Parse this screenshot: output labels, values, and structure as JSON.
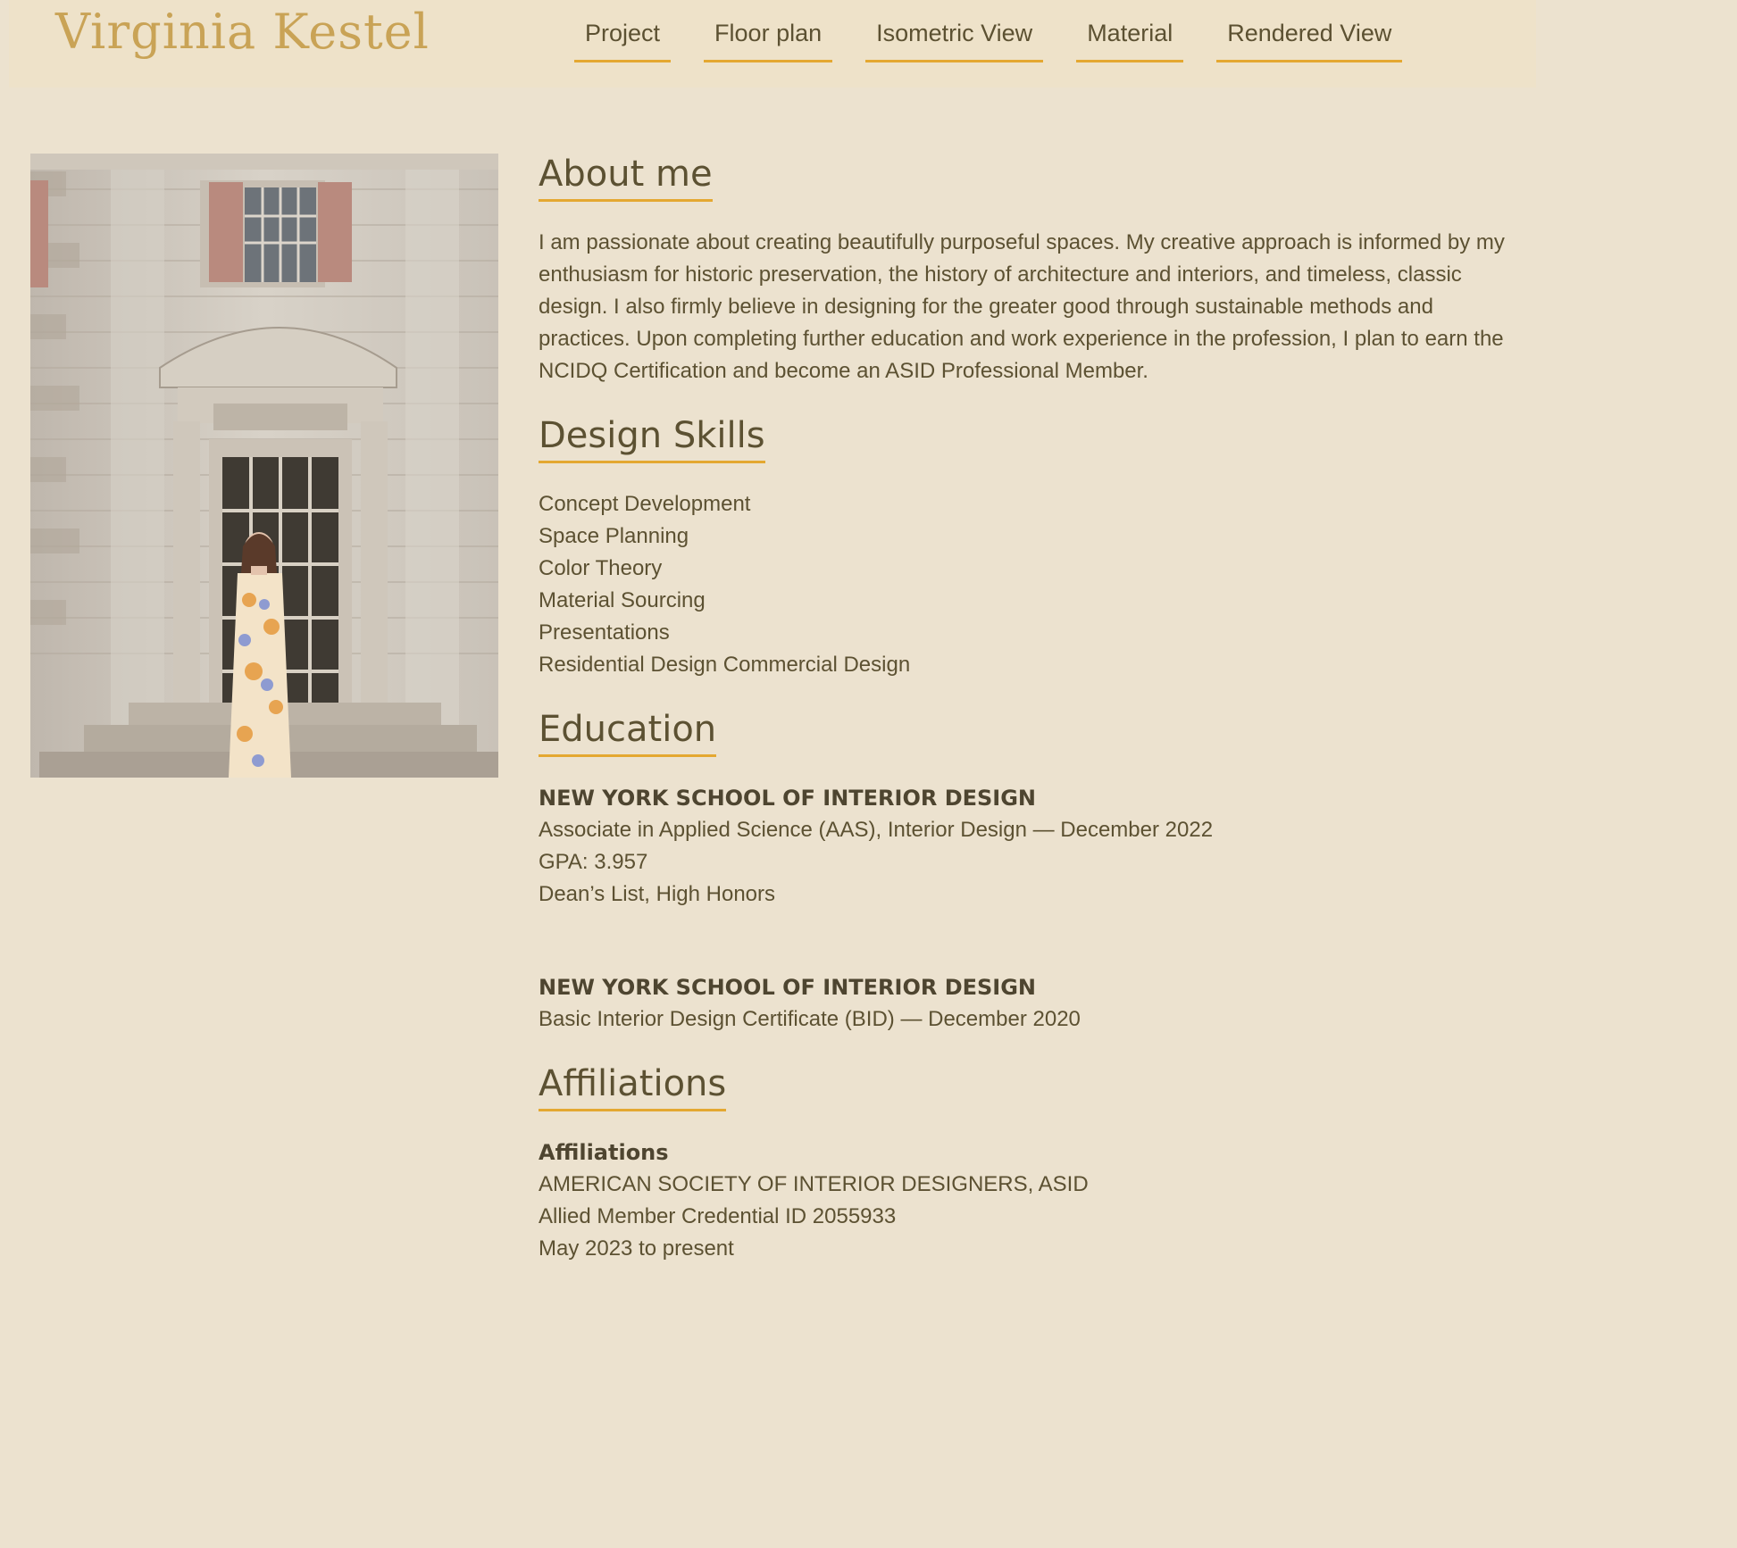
{
  "header": {
    "logo": "Virginia Kestel",
    "nav": [
      "Project",
      "Floor plan",
      "Isometric View",
      "Material",
      "Rendered View"
    ]
  },
  "about": {
    "title": "About me",
    "body": "I am passionate about creating beautifully purposeful spaces. My creative approach is informed by my enthusiasm for historic preservation, the history of architecture and interiors, and timeless, classic design. I also firmly believe in designing for the greater good through sustainable methods and practices. Upon completing further education and work experience in the profession, I plan to earn the NCIDQ Certification and become an ASID Professional Member."
  },
  "skills": {
    "title": "Design Skills",
    "items": [
      "Concept Development",
      "Space Planning",
      "Color Theory",
      "Material Sourcing",
      "Presentations",
      "Residential Design Commercial Design"
    ]
  },
  "education": {
    "title": "Education",
    "entries": [
      {
        "school": "NEW YORK SCHOOL OF INTERIOR DESIGN",
        "lines": [
          "Associate in Applied Science (AAS), Interior Design — December 2022",
          "GPA: 3.957",
          "Dean’s List, High Honors"
        ]
      },
      {
        "school": "NEW YORK SCHOOL OF INTERIOR DESIGN",
        "lines": [
          "Basic Interior Design Certificate (BID) — December 2020"
        ]
      }
    ]
  },
  "affiliations": {
    "title": "Affiliations",
    "heading": "Affiliations",
    "lines": [
      "AMERICAN SOCIETY OF INTERIOR DESIGNERS, ASID",
      "Allied Member Credential ID 2055933",
      "May 2023 to present"
    ]
  },
  "colors": {
    "background": "#ece2cf",
    "header_bg": "#eee2c9",
    "accent": "#e4a831",
    "logo": "#c9a356",
    "text": "#5c5132"
  }
}
